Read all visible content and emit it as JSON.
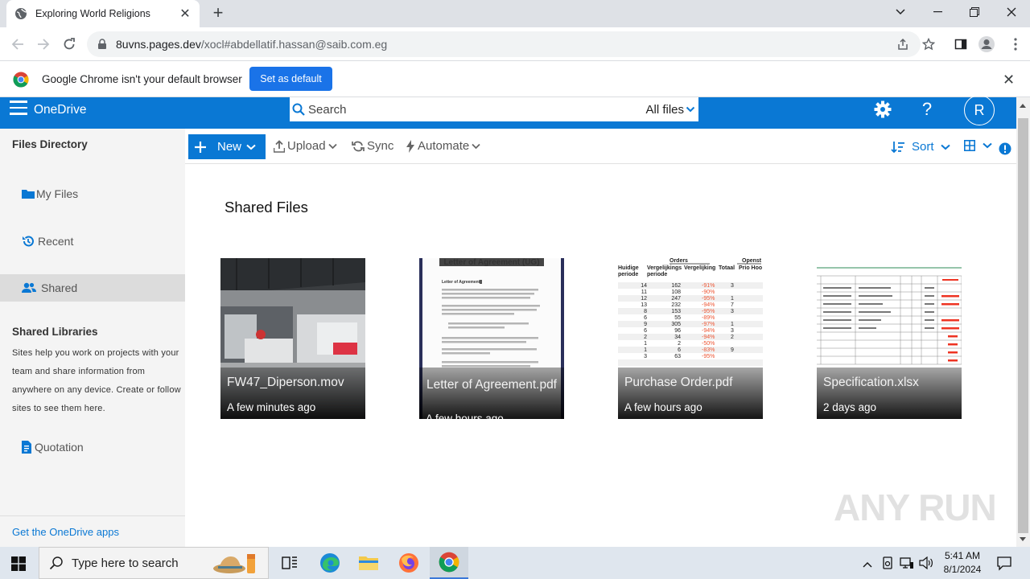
{
  "browser": {
    "tab_title": "Exploring World Religions",
    "url_host": "8uvns.pages.dev",
    "url_path": "/xocl#abdellatif.hassan@saib.com.eg",
    "infobar_message": "Google Chrome isn't your default browser",
    "infobar_button": "Set as default"
  },
  "header": {
    "brand": "OneDrive",
    "search_placeholder": "Search",
    "search_scope": "All files",
    "avatar_initial": "R",
    "help_label": "?"
  },
  "sidebar": {
    "title": "Files Directory",
    "items": [
      {
        "label": "My Files",
        "icon": "folder-icon"
      },
      {
        "label": "Recent",
        "icon": "history-icon"
      },
      {
        "label": "Shared",
        "icon": "people-icon"
      }
    ],
    "libraries_title": "Shared Libraries",
    "libraries_text": "Sites help you work on projects with your team and share information from anywhere on any device. Create or follow sites to see them here.",
    "quotation_label": "Quotation",
    "apps_link": "Get the OneDrive apps"
  },
  "commands": {
    "new": "New",
    "upload": "Upload",
    "sync": "Sync",
    "automate": "Automate",
    "sort": "Sort"
  },
  "main": {
    "title": "Shared Files",
    "files": [
      {
        "name": "FW47_Diperson.mov",
        "date": "A few minutes ago"
      },
      {
        "name": "Letter of Agreement.pdf",
        "date": "A few hours ago"
      },
      {
        "name": "Purchase Order.pdf",
        "date": "A few hours ago"
      },
      {
        "name": "Specification.xlsx",
        "date": "2 days ago"
      }
    ]
  },
  "watermark": "ANY RUN",
  "taskbar": {
    "search_placeholder": "Type here to search",
    "time": "5:41 AM",
    "date": "8/1/2024"
  },
  "colors": {
    "onedrive_blue": "#0a78d4",
    "sidebar_bg": "#f4f4f4",
    "chrome_blue": "#1a73e8"
  }
}
